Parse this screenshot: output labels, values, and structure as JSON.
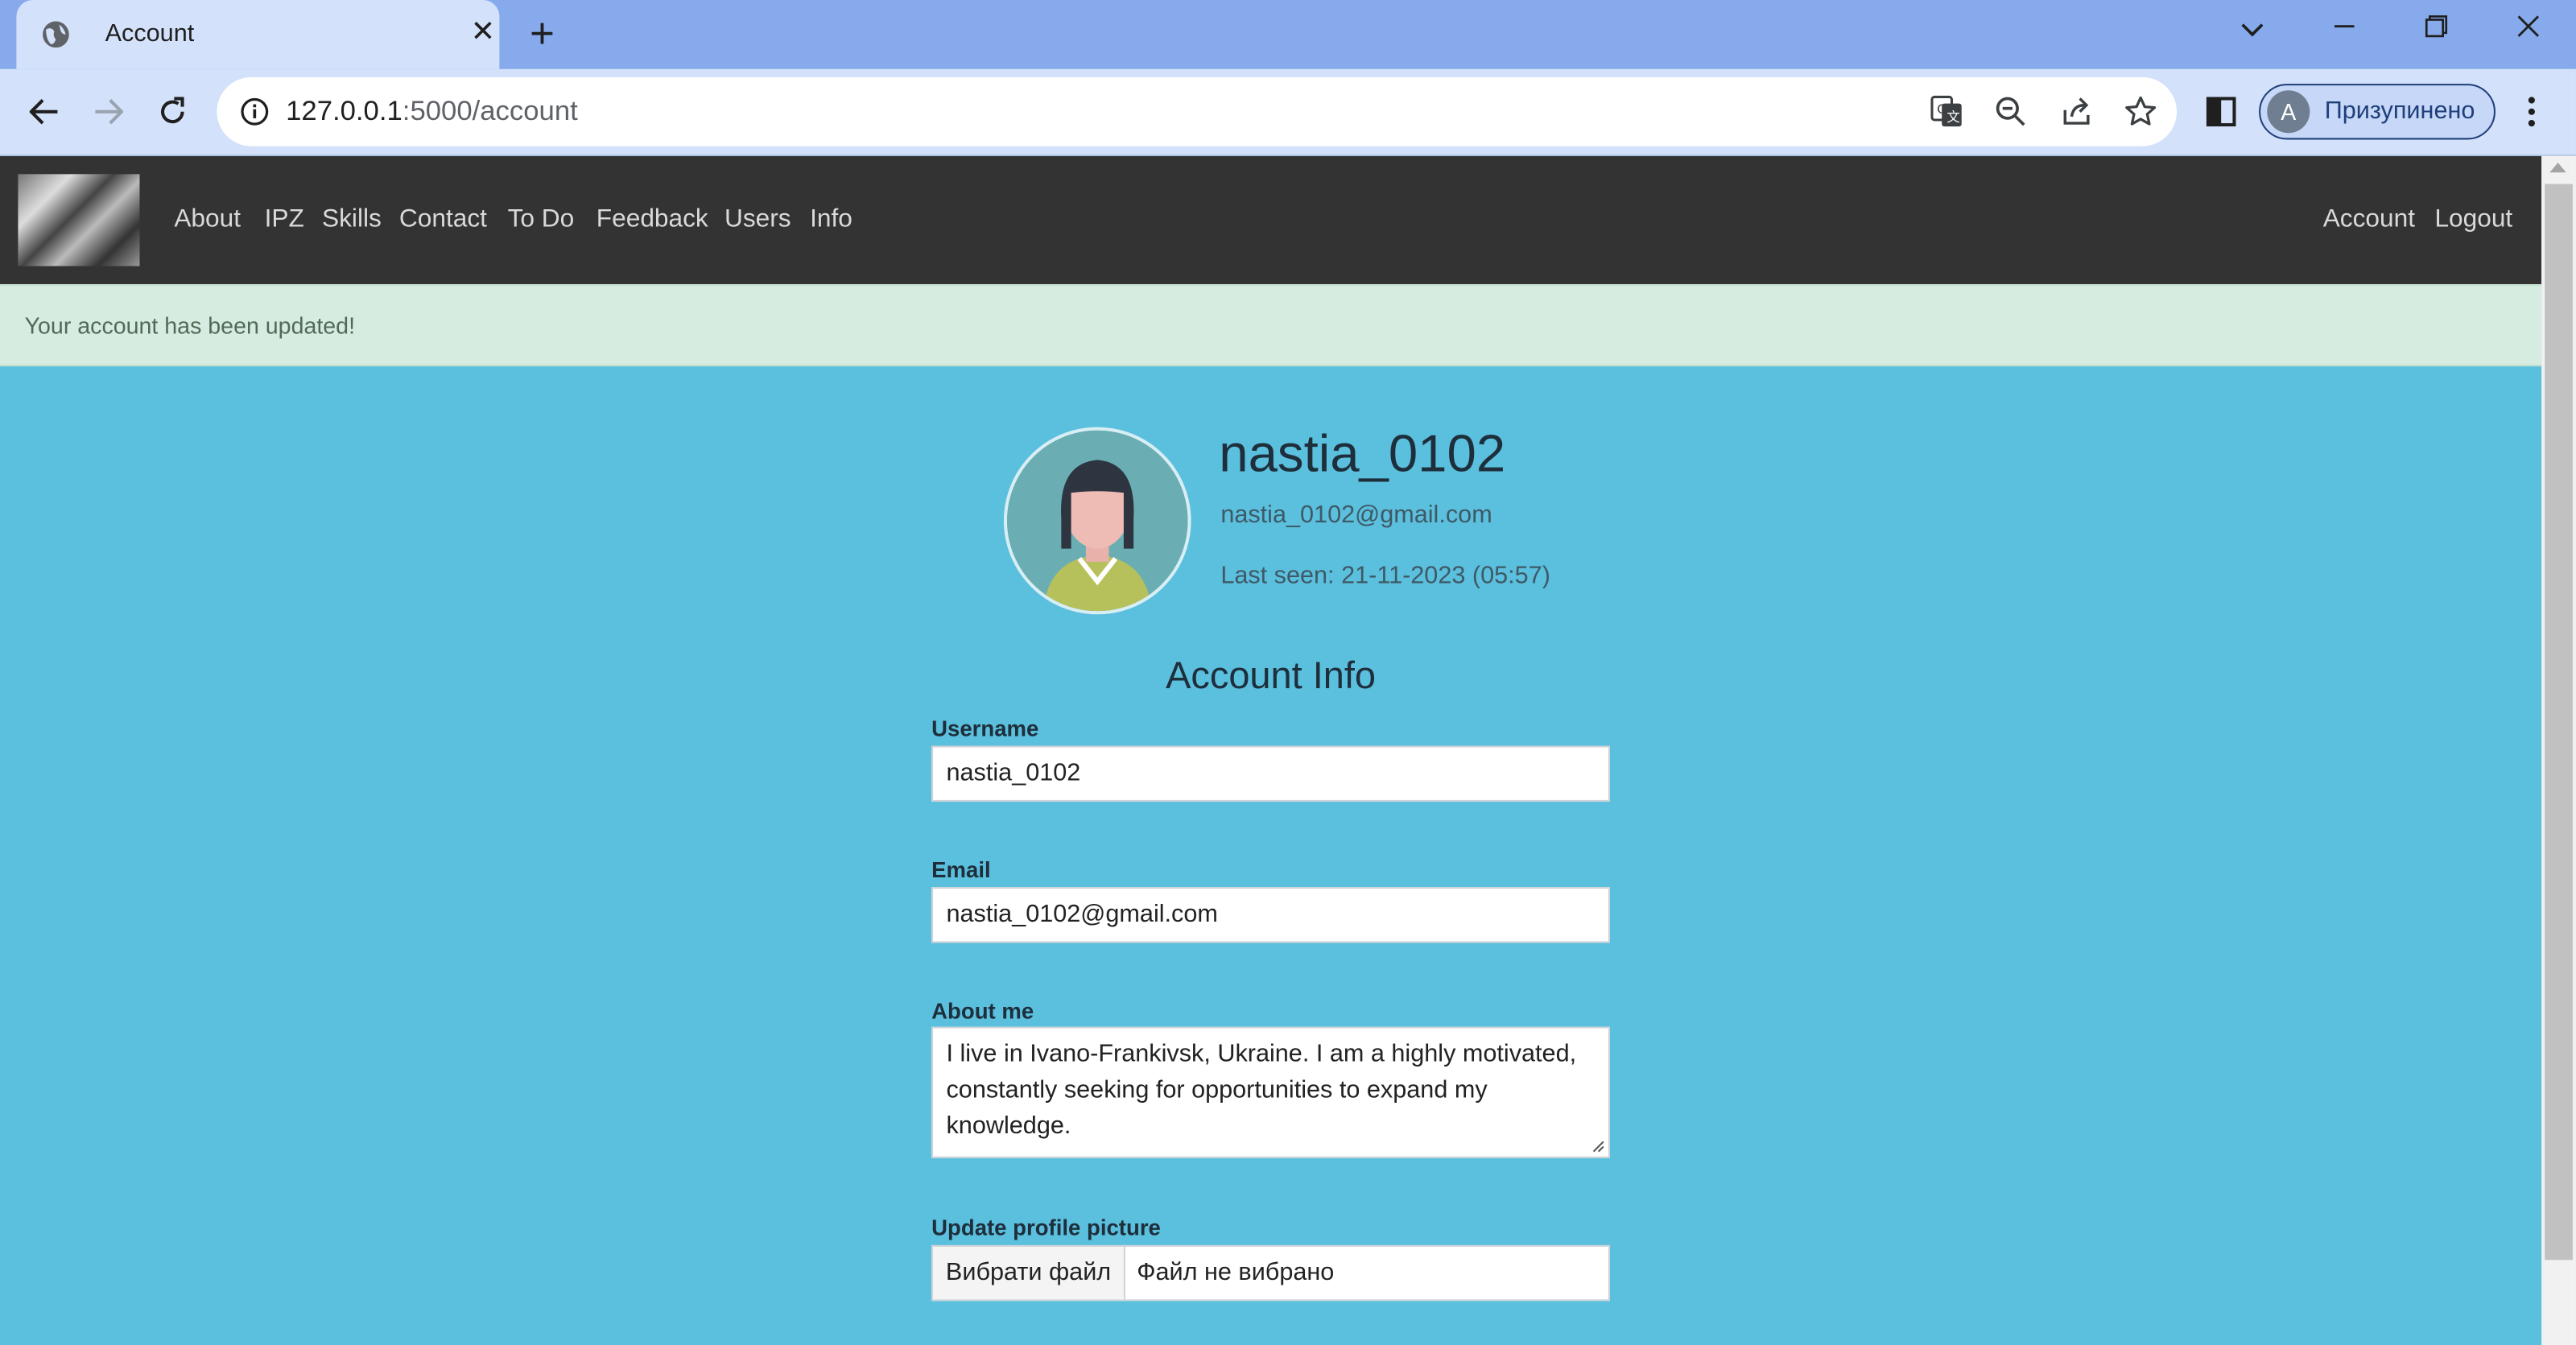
{
  "browser": {
    "tab_title": "Account",
    "url_host": "127.0.0.1",
    "url_path": ":5000/account",
    "profile_initial": "A",
    "profile_status": "Призупинено"
  },
  "navbar": {
    "links": [
      "About",
      "IPZ",
      "Skills",
      "Contact",
      "To Do",
      "Feedback",
      "Users",
      "Info"
    ],
    "right_links": [
      "Account",
      "Logout"
    ]
  },
  "alert": {
    "message": "Your account has been updated!"
  },
  "profile": {
    "username": "nastia_0102",
    "email": "nastia_0102@gmail.com",
    "last_seen": "Last seen: 21-11-2023 (05:57)"
  },
  "form": {
    "title": "Account Info",
    "username_label": "Username",
    "username_value": "nastia_0102",
    "email_label": "Email",
    "email_value": "nastia_0102@gmail.com",
    "about_label": "About me",
    "about_value": "I live in Ivano-Frankivsk, Ukraine. I am a highly motivated, constantly seeking for opportunities to expand my knowledge.",
    "picture_label": "Update profile picture",
    "file_button": "Вибрати файл",
    "file_status": "Файл не вибрано"
  },
  "colors": {
    "page_bg": "#5bbfde",
    "navbar_bg": "#333333",
    "alert_bg": "#d7ece0",
    "chrome_bg": "#86aaeb",
    "toolbar_bg": "#d3e1fa"
  }
}
